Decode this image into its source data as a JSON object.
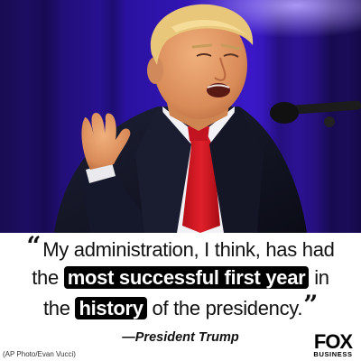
{
  "quote": {
    "open_mark": "“",
    "line1": "My administration, I think, has had",
    "line2_before": "the ",
    "line2_highlight": "most successful first year",
    "line2_after": " in",
    "line3_before": "the ",
    "line3_highlight": "history",
    "line3_after": " of the presidency.",
    "close_mark": "”"
  },
  "attribution": "—President Trump",
  "photo_credit": "(AP Photo/Evan Vucci)",
  "logo": {
    "main": "FOX",
    "sub": "BUSINESS"
  },
  "colors": {
    "highlight_background": "#000000",
    "highlight_text": "#ffffff",
    "photo_backdrop": "#2a12a0",
    "tie": "#d4121e"
  }
}
